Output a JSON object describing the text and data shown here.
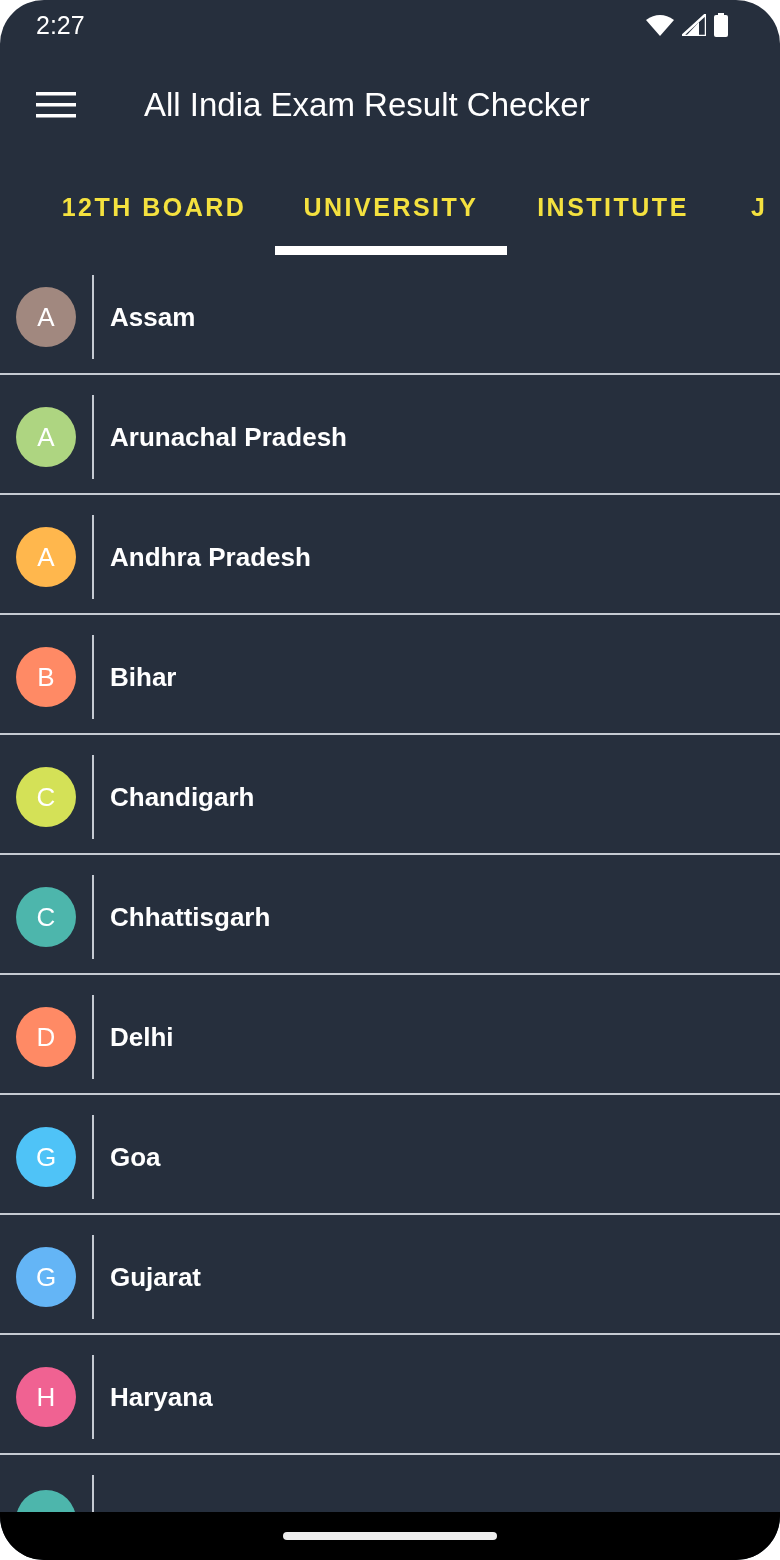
{
  "status_bar": {
    "time": "2:27"
  },
  "app_bar": {
    "title": "All India Exam Result Checker"
  },
  "tabs": [
    {
      "label": "12TH BOARD",
      "selected": false
    },
    {
      "label": "UNIVERSITY",
      "selected": true
    },
    {
      "label": "INSTITUTE",
      "selected": false
    },
    {
      "label": "J",
      "selected": false
    }
  ],
  "states": [
    {
      "initial": "A",
      "name": "Assam",
      "color": "#a1887f"
    },
    {
      "initial": "A",
      "name": "Arunachal Pradesh",
      "color": "#aed581"
    },
    {
      "initial": "A",
      "name": "Andhra Pradesh",
      "color": "#ffb74d"
    },
    {
      "initial": "B",
      "name": "Bihar",
      "color": "#ff8a65"
    },
    {
      "initial": "C",
      "name": "Chandigarh",
      "color": "#d4e157"
    },
    {
      "initial": "C",
      "name": "Chhattisgarh",
      "color": "#4db6ac"
    },
    {
      "initial": "D",
      "name": "Delhi",
      "color": "#ff8a65"
    },
    {
      "initial": "G",
      "name": "Goa",
      "color": "#4fc3f7"
    },
    {
      "initial": "G",
      "name": "Gujarat",
      "color": "#64b5f6"
    },
    {
      "initial": "H",
      "name": "Haryana",
      "color": "#f06292"
    }
  ],
  "partial_row": {
    "color": "#4db6ac"
  }
}
